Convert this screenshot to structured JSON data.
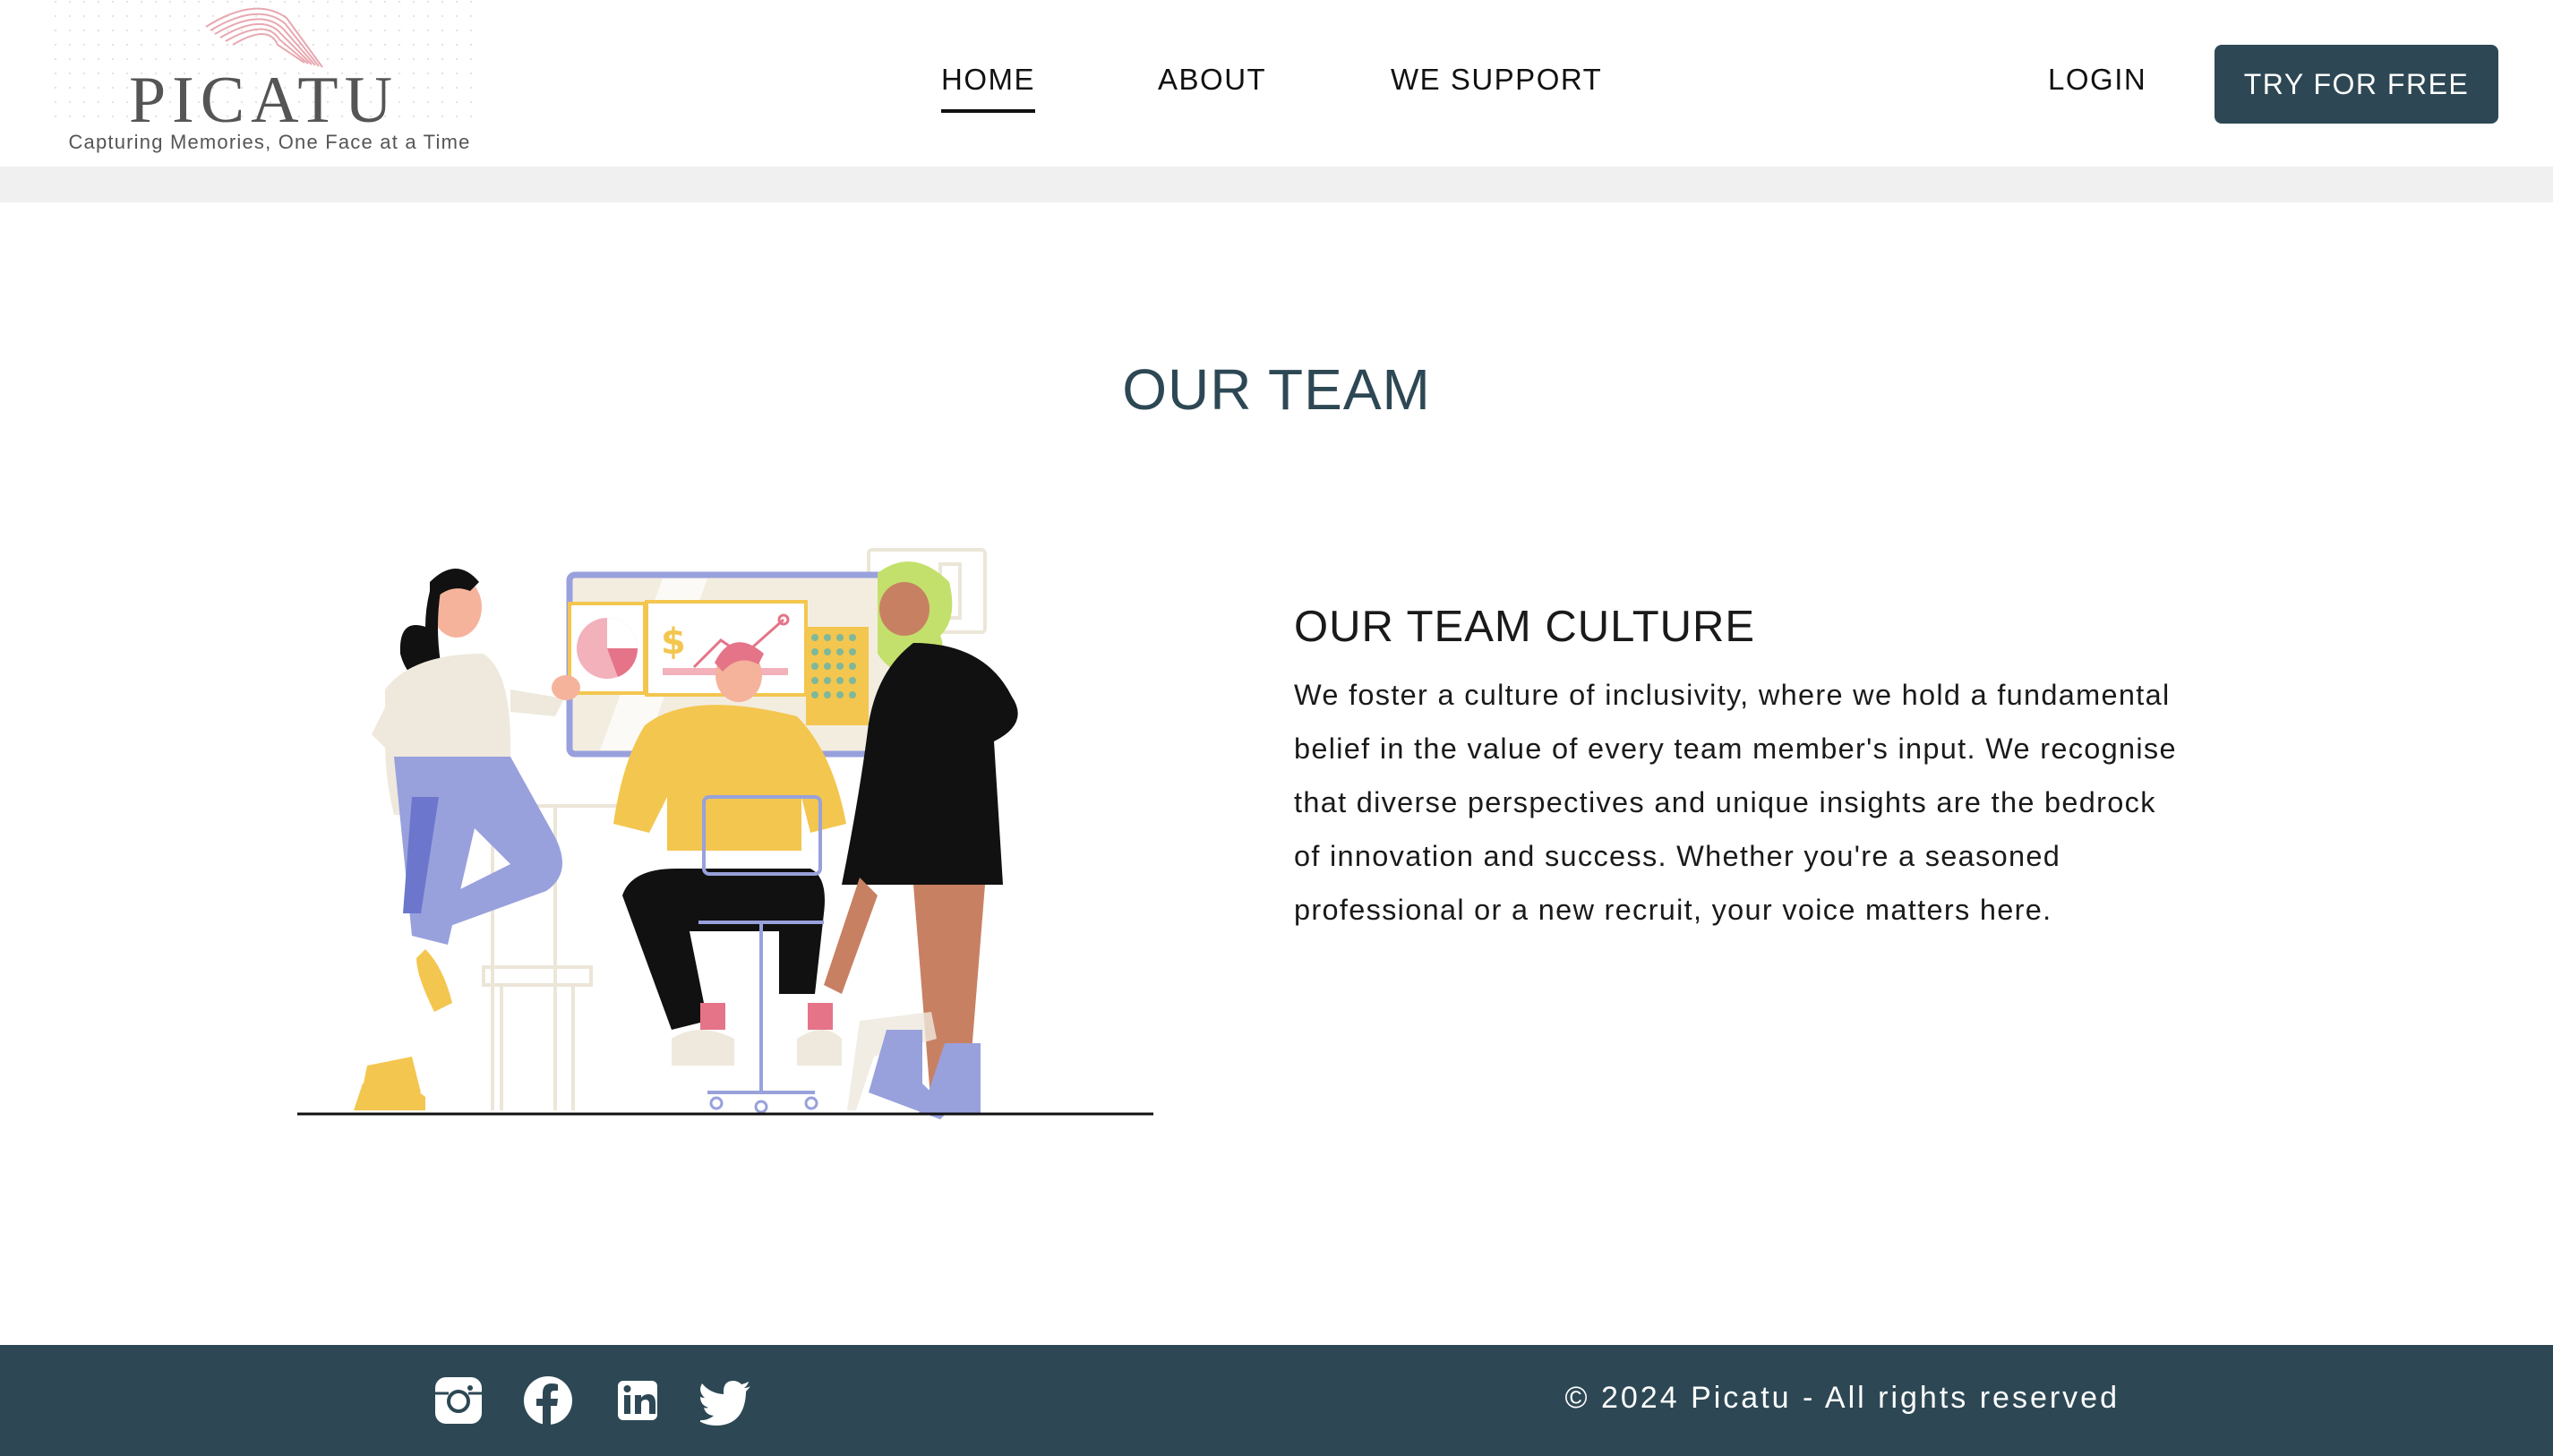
{
  "brand": {
    "name": "PICATU",
    "tagline": "Capturing Memories, One Face at a Time"
  },
  "nav": {
    "items": [
      "HOME",
      "ABOUT",
      "WE SUPPORT"
    ],
    "active": "HOME",
    "login": "LOGIN",
    "cta": "TRY FOR FREE"
  },
  "main": {
    "section_title": "OUR TEAM",
    "culture": {
      "heading": "OUR TEAM CULTURE",
      "body": "We foster a culture of inclusivity, where we hold a fundamental belief in the value of every team member's input. We recognise that diverse perspectives and unique insights are the bedrock of innovation and success. Whether you're a seasoned professional or a new recruit, your voice matters here."
    }
  },
  "footer": {
    "social_icons": [
      "instagram-icon",
      "facebook-icon",
      "linkedin-icon",
      "twitter-icon"
    ],
    "copyright": "© 2024 Picatu - All rights reserved"
  },
  "colors": {
    "brand_dark": "#2d4854",
    "band_gray": "#f0f0f0",
    "text": "#1a1a1a"
  }
}
